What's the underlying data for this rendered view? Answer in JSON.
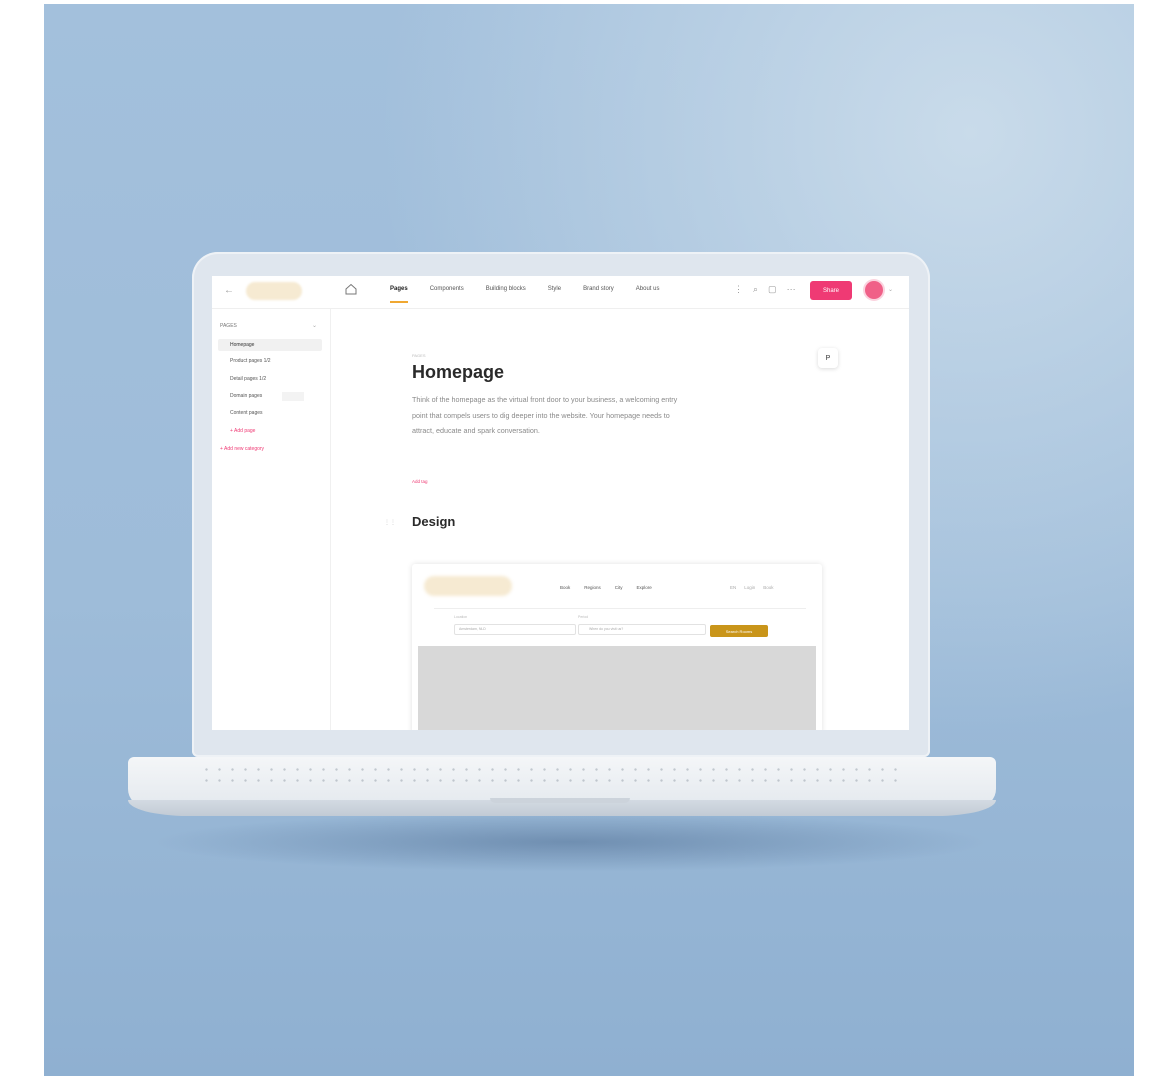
{
  "window": {
    "title": ""
  },
  "topbar": {
    "nav": [
      "Pages",
      "Components",
      "Building blocks",
      "Style",
      "Brand story",
      "About us"
    ],
    "active_nav": "Pages",
    "share_label": "Share"
  },
  "sidebar": {
    "heading": "PAGES",
    "items": [
      {
        "label": "Homepage",
        "active": true
      },
      {
        "label": "Product pages 1/2"
      },
      {
        "label": "Detail pages 1/2"
      },
      {
        "label": "Domain pages"
      },
      {
        "label": "Content pages"
      }
    ],
    "add_page": "+ Add page",
    "add_category": "+ Add new category"
  },
  "main": {
    "breadcrumb": "PAGES",
    "title": "Homepage",
    "intro": "Think of the homepage as the virtual front door to your business, a welcoming entry point that compels users to dig deeper into the website. Your homepage needs to attract, educate and spark conversation.",
    "add_tag": "Add tag",
    "section_title": "Design"
  },
  "preview": {
    "nav": [
      "Book",
      "Regions",
      "City",
      "Explore"
    ],
    "tools": [
      "EN",
      "Login",
      "Book"
    ],
    "fields": [
      {
        "label": "Location",
        "placeholder": "Amsterdam, NLD"
      },
      {
        "label": "Period",
        "placeholder": "When do you visit us?"
      }
    ],
    "button": "Search Rooms"
  },
  "colors": {
    "accent": "#ef3a74",
    "tab_underline": "#f0a832",
    "preview_button": "#c9951a",
    "background": "#a3c0dc"
  }
}
